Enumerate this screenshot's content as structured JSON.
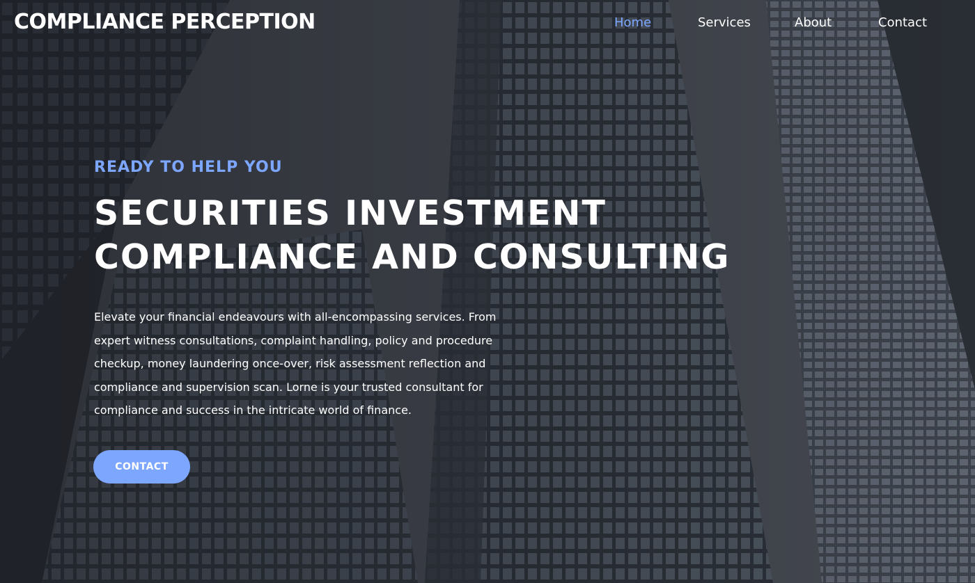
{
  "brand": {
    "name": "COMPLIANCE PERCEPTION"
  },
  "nav": {
    "items": [
      {
        "label": "Home",
        "active": true
      },
      {
        "label": "Services",
        "active": false
      },
      {
        "label": "About",
        "active": false
      },
      {
        "label": "Contact",
        "active": false
      }
    ]
  },
  "hero": {
    "eyebrow": "READY TO HELP YOU",
    "headline_line1": "SECURITIES INVESTMENT",
    "headline_line2": "COMPLIANCE AND CONSULTING",
    "description": "Elevate your financial endeavours with all-encompassing services. From expert witness consultations, complaint handling, policy and procedure checkup, money laundering once-over, risk assessment reflection and compliance and supervision scan. Lorne is your trusted consultant for compliance and success in the intricate world of finance.",
    "cta_label": "CONTACT",
    "background": "skyscrapers-photo"
  },
  "colors": {
    "accent": "#7da6ff",
    "text": "#ffffff",
    "background": "#2e3138"
  }
}
